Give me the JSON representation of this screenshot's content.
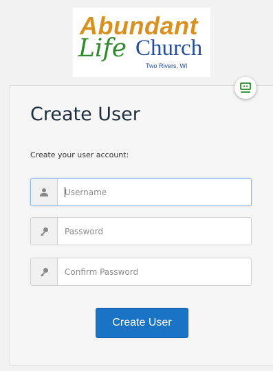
{
  "logo": {
    "line1": "Abundant",
    "line2a": "Life",
    "line2b": "Church",
    "line3": "Two Rivers, WI"
  },
  "form": {
    "title": "Create User",
    "subtitle": "Create your user account:",
    "username": {
      "placeholder": "Username",
      "value": "",
      "icon": "user-icon"
    },
    "password": {
      "placeholder": "Password",
      "value": "",
      "icon": "key-icon"
    },
    "confirm_password": {
      "placeholder": "Confirm Password",
      "value": "",
      "icon": "key-icon"
    },
    "submit_label": "Create User"
  },
  "extension_badge": {
    "icon": "password-manager-icon"
  },
  "colors": {
    "accent": "#1a73c4",
    "logo_orange": "#d8901f",
    "logo_green": "#2f8a2b",
    "logo_blue": "#234e9c"
  }
}
